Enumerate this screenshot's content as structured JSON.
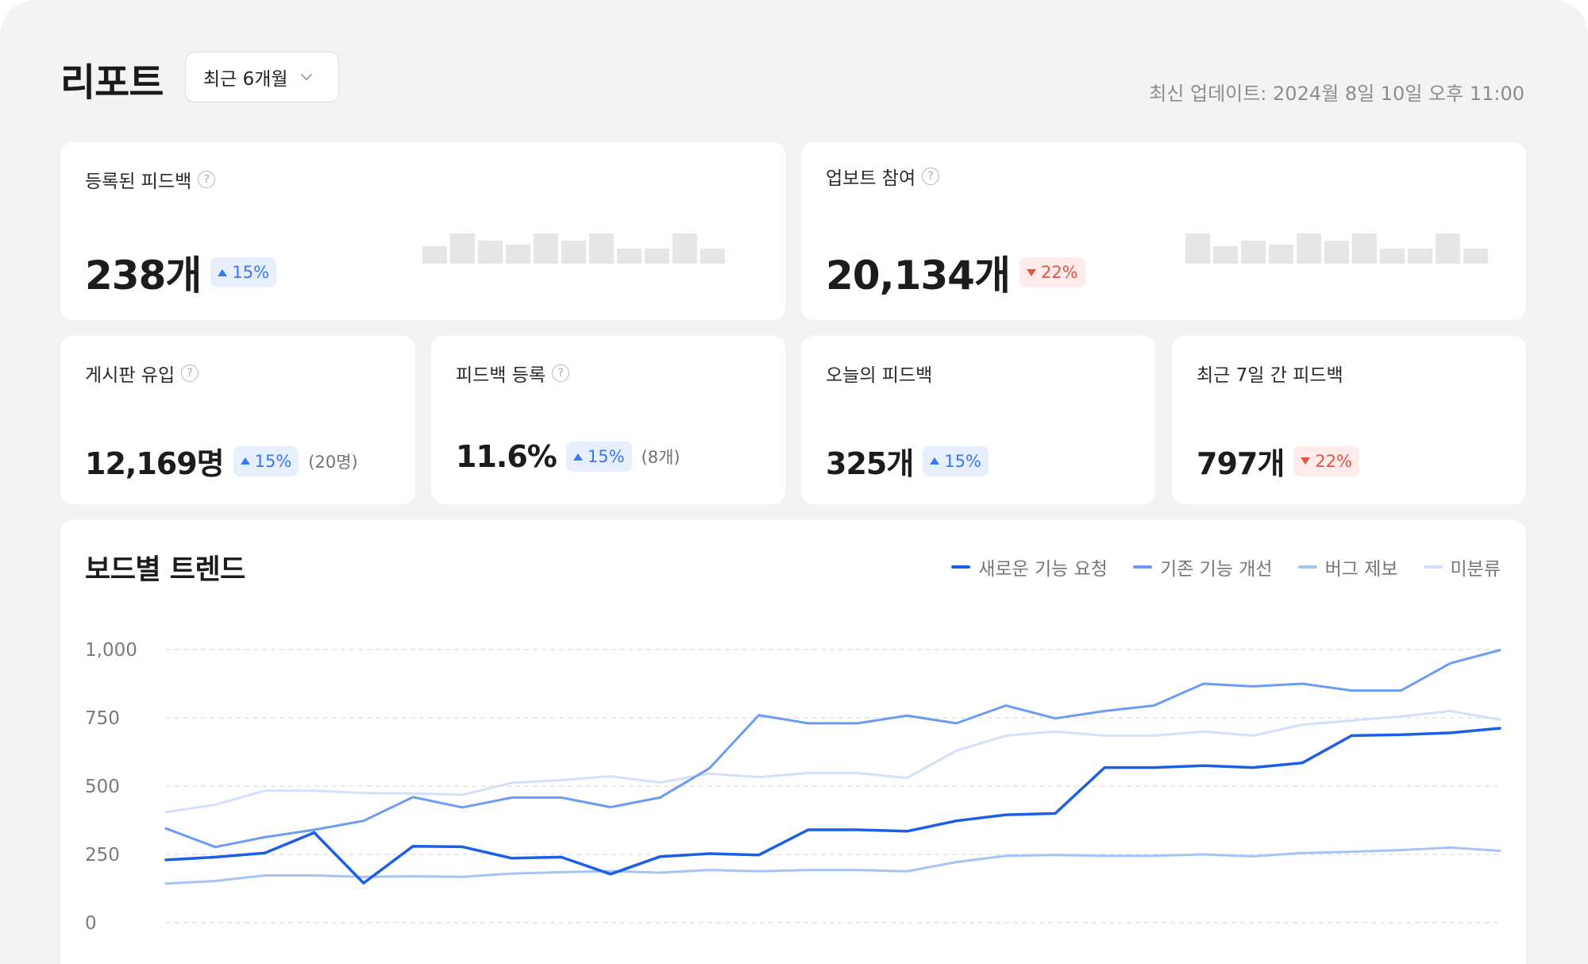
{
  "header": {
    "title": "리포트",
    "period_select": {
      "value": "최근 6개월"
    },
    "updated": "최신 업데이트: 2024월 8일 10일 오후 11:00"
  },
  "cards": {
    "registered_feedback": {
      "title": "등록된 피드백",
      "value": "238개",
      "change": "15%",
      "trend": "up",
      "mini_bars": [
        0.45,
        0.8,
        0.6,
        0.5,
        0.8,
        0.6,
        0.8,
        0.4,
        0.4,
        0.8,
        0.4
      ]
    },
    "upvote_participation": {
      "title": "업보트 참여",
      "value": "20,134개",
      "change": "22%",
      "trend": "down",
      "mini_bars": [
        0.8,
        0.45,
        0.6,
        0.5,
        0.8,
        0.6,
        0.8,
        0.4,
        0.4,
        0.8,
        0.4
      ]
    },
    "board_inflow": {
      "title": "게시판 유입",
      "value": "12,169명",
      "change": "15%",
      "trend": "up",
      "note": "(20명)"
    },
    "feedback_registration": {
      "title": "피드백 등록",
      "value": "11.6%",
      "change": "15%",
      "trend": "up",
      "note": "(8개)"
    },
    "today_feedback": {
      "title": "오늘의 피드백",
      "value": "325개",
      "change": "15%",
      "trend": "up"
    },
    "last7_feedback": {
      "title": "최근 7일 간 피드백",
      "value": "797개",
      "change": "22%",
      "trend": "down"
    }
  },
  "chart_data": {
    "type": "line",
    "title": "보드별 트렌드",
    "ylim": [
      0,
      1000
    ],
    "yticks": [
      0,
      250,
      500,
      750,
      1000
    ],
    "ytick_labels": [
      "0",
      "250",
      "500",
      "750",
      "1,000"
    ],
    "grid": true,
    "legend_position": "top-right",
    "series": [
      {
        "name": "새로운 기능 요청",
        "color": "#1a5fe6",
        "values": [
          230,
          240,
          255,
          330,
          145,
          280,
          278,
          236,
          240,
          178,
          242,
          253,
          248,
          340,
          340,
          335,
          373,
          395,
          400,
          568,
          568,
          575,
          568,
          585,
          685,
          688,
          695,
          712
        ]
      },
      {
        "name": "기존 기능 개선",
        "color": "#6b9cf4",
        "values": [
          345,
          277,
          313,
          340,
          373,
          460,
          422,
          458,
          458,
          423,
          458,
          565,
          760,
          730,
          730,
          758,
          730,
          795,
          748,
          775,
          795,
          875,
          865,
          875,
          850,
          850,
          950,
          998
        ]
      },
      {
        "name": "버그 제보",
        "color": "#a6c3f8",
        "values": [
          143,
          153,
          173,
          173,
          168,
          170,
          168,
          180,
          185,
          189,
          183,
          193,
          188,
          193,
          193,
          188,
          222,
          245,
          248,
          245,
          245,
          250,
          243,
          255,
          260,
          266,
          275,
          263
        ]
      },
      {
        "name": "미분류",
        "color": "#d2e1fb",
        "values": [
          405,
          432,
          483,
          483,
          475,
          473,
          468,
          512,
          522,
          536,
          513,
          546,
          533,
          548,
          548,
          530,
          630,
          685,
          700,
          685,
          685,
          700,
          685,
          725,
          740,
          755,
          775,
          743
        ]
      }
    ]
  }
}
